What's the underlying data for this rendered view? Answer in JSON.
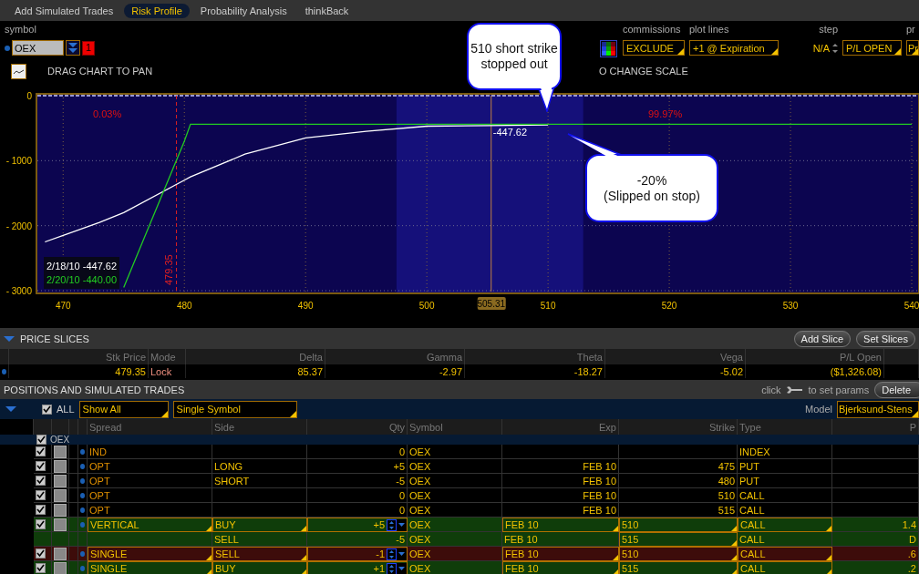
{
  "tabs": [
    {
      "label": "Add Simulated Trades",
      "selected": false
    },
    {
      "label": "Risk Profile",
      "selected": true
    },
    {
      "label": "Probability Analysis",
      "selected": false
    },
    {
      "label": "thinkBack",
      "selected": false
    }
  ],
  "symbol_bar": {
    "symbol_label": "symbol",
    "symbol": "OEX",
    "badge": "1",
    "commissions": {
      "label": "commissions",
      "value": "EXCLUDE"
    },
    "plot_lines": {
      "label": "plot lines",
      "value": "+1 @ Expiration"
    },
    "step": {
      "label": "step",
      "value": "N/A"
    },
    "pl_mode": "P/L OPEN",
    "product": {
      "label": "pr",
      "value": "Pr"
    }
  },
  "chart_hints": [
    "DRAG CHART TO PAN",
    "O CHANGE SCALE"
  ],
  "risk_chart": {
    "chart_data": {
      "type": "line",
      "x": [
        468.5,
        470,
        473,
        475,
        480,
        480.5,
        485,
        490,
        495,
        500,
        505,
        510,
        520,
        530,
        540
      ],
      "series": [
        {
          "name": "2/18/10",
          "color": "#ffffff",
          "values": [
            -2250,
            -2150,
            -1950,
            -1800,
            -1300,
            -1250,
            -900,
            -650,
            -550,
            -470,
            -460,
            -450,
            null,
            null,
            null
          ]
        },
        {
          "name": "2/20/10",
          "color": "#22cc22",
          "values": [
            null,
            null,
            null,
            -2950,
            -700,
            -440,
            -440,
            -440,
            -440,
            -440,
            -440,
            -440,
            -440,
            -440,
            -440
          ]
        }
      ],
      "xlim": [
        467.8,
        540.6
      ],
      "ylim": [
        -3042,
        28
      ],
      "xticks": [
        470,
        480,
        490,
        500,
        510,
        520,
        530,
        540
      ],
      "yticks": [
        {
          "value": 0,
          "label": "0"
        },
        {
          "value": -1000,
          "label": "- 1000"
        },
        {
          "value": -2000,
          "label": "- 2000"
        },
        {
          "value": -3000,
          "label": "- 3000"
        }
      ],
      "grid": true,
      "bands": [
        {
          "axis": "x",
          "from": 497.5,
          "to": 512.9,
          "color": "#15107a"
        }
      ],
      "ref_lines": [
        {
          "axis": "x",
          "value": 479.35,
          "color": "#e02020"
        },
        {
          "axis": "x",
          "value": 505.31,
          "color": "#c08040"
        }
      ]
    },
    "probabilities": [
      "0.03%",
      "99.97%"
    ],
    "slice_price": "479.35",
    "current_price": "505.31",
    "cursor_value": "-447.62",
    "legend_values": [
      "-447.62",
      "-440.00"
    ]
  },
  "callouts": [
    {
      "lines": [
        "510 short strike",
        "stopped out"
      ]
    },
    {
      "lines": [
        "-20%",
        "(Slipped on stop)"
      ]
    }
  ],
  "price_slices": {
    "title": "PRICE SLICES",
    "expanded": true,
    "buttons": [
      "Add Slice",
      "Set Slices"
    ],
    "columns": [
      "Stk Price",
      "Mode",
      "Delta",
      "Gamma",
      "Theta",
      "Vega",
      "P/L Open"
    ],
    "rows": [
      {
        "cells": [
          "479.35",
          "Lock",
          "85.37",
          "-2.97",
          "-18.27",
          "-5.02",
          "($1,326.08)"
        ]
      }
    ]
  },
  "positions": {
    "title": "POSITIONS AND SIMULATED TRADES",
    "hint_before": "click",
    "hint_after": "to set params",
    "delete_button": "Delete",
    "all_label": "ALL",
    "all_checked": true,
    "filters": [
      "Show All",
      "Single Symbol"
    ],
    "model_label": "Model",
    "model": "Bjerksund-Stens",
    "columns": [
      "Spread",
      "Side",
      "Qty",
      "Symbol",
      "Exp",
      "Strike",
      "Type",
      "P"
    ],
    "group": {
      "label": "OEX",
      "checked": true,
      "expanded": true
    },
    "rows": [
      {
        "kind": "position",
        "checked": true,
        "cells": [
          "IND",
          "",
          "0",
          "OEX",
          "",
          "",
          "INDEX",
          ""
        ]
      },
      {
        "kind": "position",
        "checked": true,
        "cells": [
          "OPT",
          "LONG",
          "+5",
          "OEX",
          "FEB 10",
          "475",
          "PUT",
          ""
        ]
      },
      {
        "kind": "position",
        "checked": true,
        "cells": [
          "OPT",
          "SHORT",
          "-5",
          "OEX",
          "FEB 10",
          "480",
          "PUT",
          ""
        ]
      },
      {
        "kind": "position",
        "checked": true,
        "cells": [
          "OPT",
          "",
          "0",
          "OEX",
          "FEB 10",
          "510",
          "CALL",
          ""
        ]
      },
      {
        "kind": "position",
        "checked": true,
        "cells": [
          "OPT",
          "",
          "0",
          "OEX",
          "FEB 10",
          "515",
          "CALL",
          ""
        ]
      },
      {
        "kind": "trade",
        "checked": true,
        "color": "#0f3d0a",
        "cells": [
          "VERTICAL",
          "BUY",
          "+5",
          "OEX",
          "FEB 10",
          "510",
          "CALL",
          "1.4"
        ]
      },
      {
        "kind": "leg",
        "color": "#0f3d0a",
        "cells": [
          "",
          "SELL",
          "-5",
          "OEX",
          "FEB 10",
          "515",
          "CALL",
          "D"
        ]
      },
      {
        "kind": "trade",
        "checked": true,
        "color": "#3d0c0a",
        "cells": [
          "SINGLE",
          "SELL",
          "-1",
          "OEX",
          "FEB 10",
          "510",
          "CALL",
          ".6"
        ]
      },
      {
        "kind": "trade",
        "checked": true,
        "color": "#0f3d0a",
        "cells": [
          "SINGLE",
          "BUY",
          "+1",
          "OEX",
          "FEB 10",
          "515",
          "CALL",
          ".2"
        ]
      }
    ]
  }
}
